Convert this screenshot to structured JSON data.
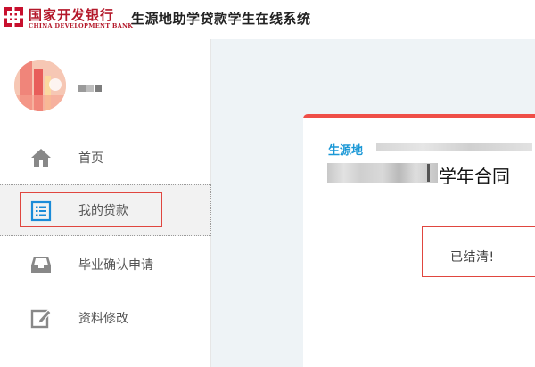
{
  "header": {
    "bank_name_cn": "国家开发银行",
    "bank_name_en": "CHINA DEVELOPMENT BANK",
    "system_title": "生源地助学贷款学生在线系统"
  },
  "sidebar": {
    "items": [
      {
        "label": "首页",
        "icon": "home-icon"
      },
      {
        "label": "我的贷款",
        "icon": "loan-list-icon"
      },
      {
        "label": "毕业确认申请",
        "icon": "inbox-icon"
      },
      {
        "label": "资料修改",
        "icon": "edit-icon"
      }
    ]
  },
  "card": {
    "region_label": "生源地",
    "contract_suffix": "学年合同",
    "status": "已结清!"
  },
  "colors": {
    "brand_red": "#b4182a",
    "accent_red": "#ef4e47",
    "region_blue": "#1b98d6",
    "icon_blue": "#1b8bd8"
  }
}
